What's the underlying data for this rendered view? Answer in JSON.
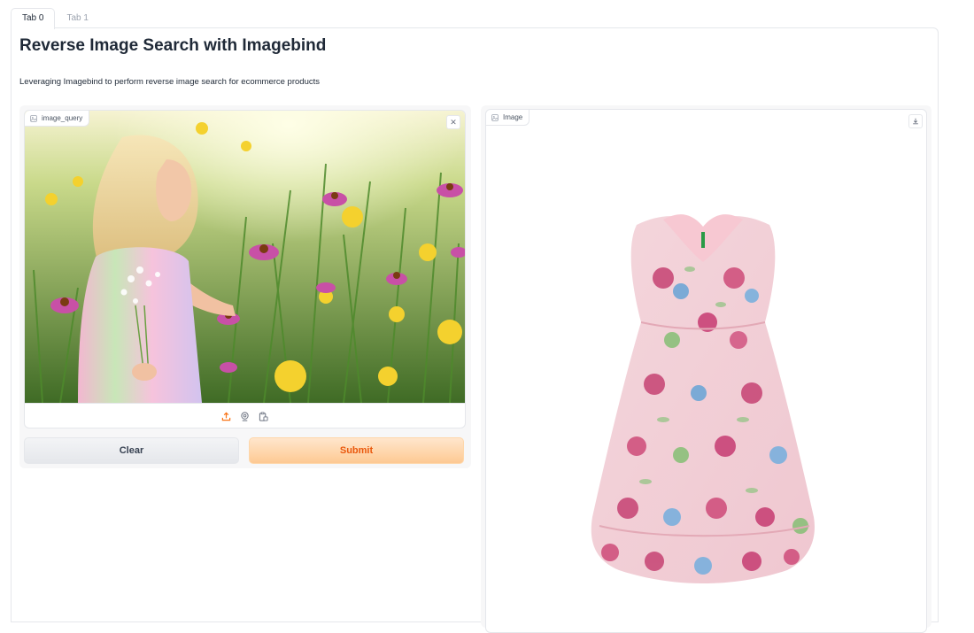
{
  "tabs": [
    {
      "label": "Tab 0",
      "active": true
    },
    {
      "label": "Tab 1",
      "active": false
    }
  ],
  "header": {
    "title": "Reverse Image Search with Imagebind",
    "description": "Leveraging Imagebind to perform reverse image search for ecommerce products"
  },
  "input_image": {
    "label": "image_query",
    "sources": [
      "upload-icon",
      "webcam-icon",
      "clipboard-icon"
    ]
  },
  "buttons": {
    "clear": "Clear",
    "submit": "Submit"
  },
  "output_image": {
    "label": "Image"
  },
  "colors": {
    "accent": "#f97316",
    "submit_bg": "#fdc993",
    "clear_bg": "#e5e7eb"
  }
}
